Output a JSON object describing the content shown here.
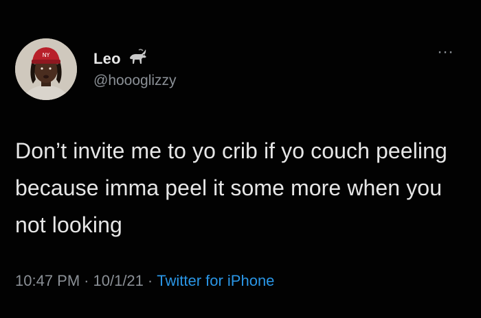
{
  "user": {
    "display_name": "Leo",
    "handle": "@hoooglizzy",
    "emoji_icon": "goat-icon"
  },
  "tweet": {
    "text": "Don’t invite me to yo crib if yo couch peeling because imma peel it some more when you not looking",
    "time": "10:47 PM",
    "date": "10/1/21",
    "separator": "·",
    "source": "Twitter for iPhone"
  },
  "menu": {
    "more_label": "···"
  },
  "colors": {
    "background": "#000000",
    "text": "#e6e6e6",
    "muted": "#8b9096",
    "link": "#2a96e6"
  }
}
